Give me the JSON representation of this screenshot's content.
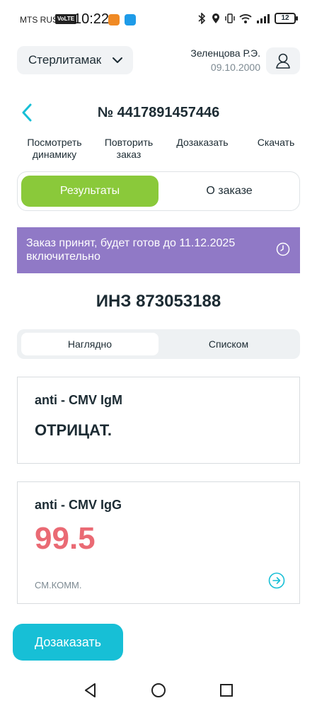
{
  "status_bar": {
    "carrier": "MTS RUS",
    "volte": "VoLTE",
    "time": "10:22",
    "battery": "12"
  },
  "header": {
    "city": "Стерлитамак",
    "user_name": "Зеленцова Р.Э.",
    "user_dob": "09.10.2000"
  },
  "order": {
    "title": "№ 4417891457446"
  },
  "actions": {
    "dynamics_line1": "Посмотреть",
    "dynamics_line2": "динамику",
    "repeat_line1": "Повторить",
    "repeat_line2": "заказ",
    "add_order": "Дозаказать",
    "download": "Скачать"
  },
  "main_tabs": {
    "results": "Результаты",
    "about": "О заказе"
  },
  "banner": {
    "text": "Заказ принят, будет готов до 11.12.2025 включительно",
    "color": "#9079c6"
  },
  "inz": "ИНЗ 873053188",
  "view_toggle": {
    "visual": "Наглядно",
    "list": "Списком"
  },
  "results": [
    {
      "name": "anti - CMV IgM",
      "value": "ОТРИЦАТ."
    },
    {
      "name": "anti - CMV IgG",
      "value": "99.5",
      "comment": "СМ.КОММ.",
      "value_color": "#ea6a74"
    }
  ],
  "reorder_button": "Дозаказать",
  "colors": {
    "accent_green": "#8ac93a",
    "accent_teal": "#17bfd6"
  }
}
